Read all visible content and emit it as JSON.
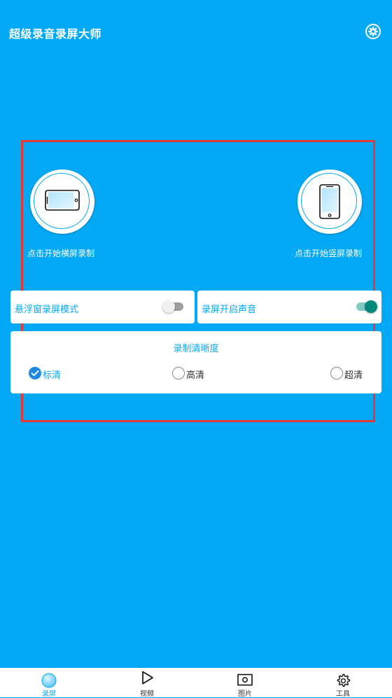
{
  "header": {
    "title": "超级录音录屏大师",
    "settings_icon": "gear-icon"
  },
  "record": {
    "landscape": {
      "label": "点击开始横屏录制",
      "icon": "landscape-phone-icon"
    },
    "portrait": {
      "label": "点击开始竖屏录制",
      "icon": "portrait-phone-icon"
    }
  },
  "toggles": {
    "floating_window": {
      "label": "悬浮窗录屏模式",
      "on": false
    },
    "record_audio": {
      "label": "录屏开启声音",
      "on": true
    }
  },
  "quality": {
    "title": "录制清晰度",
    "options": [
      {
        "label": "标清",
        "selected": true
      },
      {
        "label": "高清",
        "selected": false
      },
      {
        "label": "超清",
        "selected": false
      }
    ]
  },
  "nav": {
    "items": [
      {
        "label": "录屏",
        "icon": "record-circle-icon",
        "active": true
      },
      {
        "label": "视频",
        "icon": "play-icon",
        "active": false
      },
      {
        "label": "图片",
        "icon": "picture-icon",
        "active": false
      },
      {
        "label": "工具",
        "icon": "gear-icon",
        "active": false
      }
    ]
  },
  "colors": {
    "background": "#03A9F4",
    "accent": "#03A9F4",
    "highlight": "#E53935",
    "switch_on": "#00897B",
    "radio_checked": "#1E88E5"
  }
}
